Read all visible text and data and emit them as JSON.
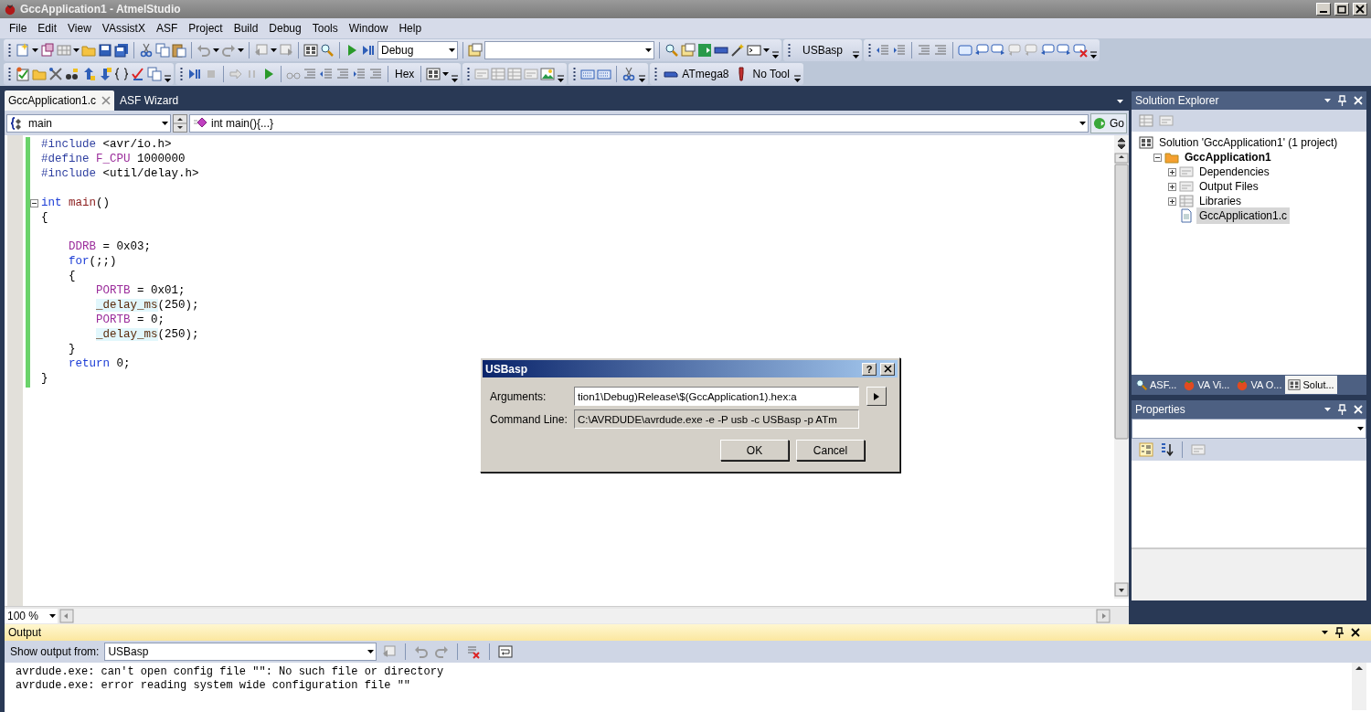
{
  "window": {
    "title": "GccApplication1 - AtmelStudio"
  },
  "menu": [
    "File",
    "Edit",
    "View",
    "VAssistX",
    "ASF",
    "Project",
    "Build",
    "Debug",
    "Tools",
    "Window",
    "Help"
  ],
  "toolbar": {
    "configuration": "Debug",
    "external_tool": "USBasp"
  },
  "toolbar2": {
    "hex_button": "Hex",
    "device": "ATmega8",
    "tool": "No Tool"
  },
  "editor": {
    "tabs": [
      {
        "label": "GccApplication1.c",
        "selected": true
      },
      {
        "label": "ASF Wizard",
        "selected": false
      }
    ],
    "scope": "main",
    "member": "int main(){...}",
    "go_button": "Go",
    "zoom": "100 %",
    "lines": [
      {
        "fold": false,
        "tokens": [
          {
            "text": "#include",
            "kind": "preprocessor"
          },
          {
            "text": " <avr/io.h>",
            "kind": "plain"
          }
        ]
      },
      {
        "fold": false,
        "tokens": [
          {
            "text": "#define",
            "kind": "preprocessor"
          },
          {
            "text": " F_CPU",
            "kind": "macro"
          },
          {
            "text": " 1000000",
            "kind": "plain"
          }
        ]
      },
      {
        "fold": false,
        "tokens": [
          {
            "text": "#include",
            "kind": "preprocessor"
          },
          {
            "text": " <util/delay.h>",
            "kind": "plain"
          }
        ]
      },
      {
        "fold": false
      },
      {
        "fold": true,
        "tokens": [
          {
            "text": "int",
            "kind": "keyword"
          },
          {
            "text": " main",
            "kind": "function"
          },
          {
            "text": "()",
            "kind": "plain"
          }
        ]
      },
      {
        "fold": false,
        "tokens": [
          {
            "text": "{",
            "kind": "plain"
          }
        ]
      },
      {
        "fold": false
      },
      {
        "fold": false,
        "tokens": [
          {
            "text": "    DDRB",
            "kind": "macro"
          },
          {
            "text": " = 0x03;",
            "kind": "plain"
          }
        ]
      },
      {
        "fold": false,
        "tokens": [
          {
            "text": "    for",
            "kind": "keyword"
          },
          {
            "text": "(;;)",
            "kind": "plain"
          }
        ]
      },
      {
        "fold": false,
        "tokens": [
          {
            "text": "    {",
            "kind": "plain"
          }
        ]
      },
      {
        "fold": false,
        "tokens": [
          {
            "text": "        PORTB",
            "kind": "macro"
          },
          {
            "text": " = 0x01;",
            "kind": "plain"
          }
        ]
      },
      {
        "fold": false,
        "tokens": [
          {
            "text": "        _delay_ms",
            "kind": "library"
          },
          {
            "text": "(250);",
            "kind": "plain"
          }
        ]
      },
      {
        "fold": false,
        "tokens": [
          {
            "text": "        PORTB",
            "kind": "macro"
          },
          {
            "text": " = 0;",
            "kind": "plain"
          }
        ]
      },
      {
        "fold": false,
        "tokens": [
          {
            "text": "        _delay_ms",
            "kind": "library"
          },
          {
            "text": "(250);",
            "kind": "plain"
          }
        ]
      },
      {
        "fold": false,
        "tokens": [
          {
            "text": "    }",
            "kind": "plain"
          }
        ]
      },
      {
        "fold": false,
        "tokens": [
          {
            "text": "    return",
            "kind": "keyword"
          },
          {
            "text": " 0;",
            "kind": "plain"
          }
        ]
      },
      {
        "fold": false,
        "tokens": [
          {
            "text": "}",
            "kind": "plain"
          }
        ]
      }
    ]
  },
  "solution_explorer": {
    "title": "Solution Explorer",
    "tree": [
      {
        "label": "Solution 'GccApplication1' (1 project)",
        "kind": "solution",
        "selected": false,
        "children": [
          {
            "label": "GccApplication1",
            "kind": "project",
            "selected": false,
            "expanded": true,
            "children": [
              {
                "label": "Dependencies",
                "kind": "folder",
                "selected": false,
                "expanded": false
              },
              {
                "label": "Output Files",
                "kind": "folder",
                "selected": false,
                "expanded": false
              },
              {
                "label": "Libraries",
                "kind": "library",
                "selected": false,
                "expanded": false
              },
              {
                "label": "GccApplication1.c",
                "kind": "file",
                "selected": true
              }
            ]
          }
        ]
      }
    ],
    "tabs": [
      {
        "label": "ASF...",
        "kind": "search",
        "selected": false
      },
      {
        "label": "VA Vi...",
        "kind": "tomato",
        "selected": false
      },
      {
        "label": "VA O...",
        "kind": "tomato",
        "selected": false
      },
      {
        "label": "Solut...",
        "kind": "solution",
        "selected": true
      }
    ]
  },
  "properties": {
    "title": "Properties"
  },
  "output": {
    "title": "Output",
    "show_from_label": "Show output from:",
    "source": "USBasp",
    "lines": [
      "avrdude.exe: can't open config file \"\": No such file or directory",
      "avrdude.exe: error reading system wide configuration file \"\""
    ]
  },
  "dialog": {
    "title": "USBasp",
    "help_button": "?",
    "fields": [
      {
        "label": "Arguments:",
        "value": "tion1\\Debug)Release\\$(GccApplication1).hex:a",
        "disabled": false
      },
      {
        "label": "Command Line:",
        "value": "C:\\AVRDUDE\\avrdude.exe -e -P usb -c USBasp -p ATm",
        "disabled": true
      }
    ],
    "buttons": [
      "OK",
      "Cancel"
    ]
  }
}
